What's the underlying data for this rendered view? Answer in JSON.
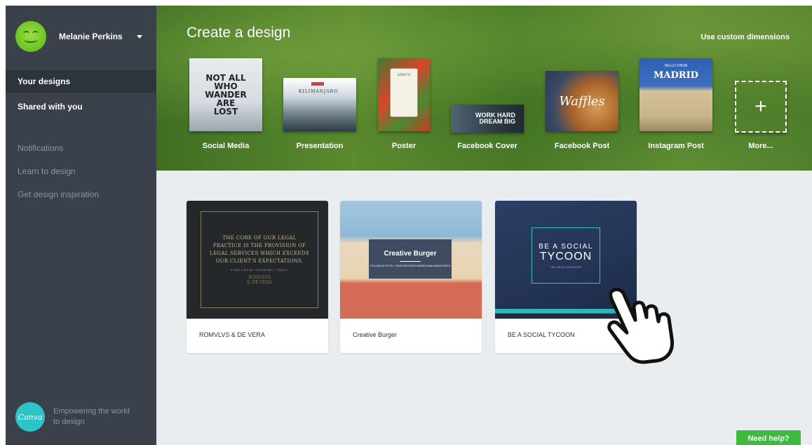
{
  "sidebar": {
    "user_name": "Melanie Perkins",
    "nav": [
      {
        "label": "Your designs",
        "active": true
      },
      {
        "label": "Shared with you",
        "active": false
      }
    ],
    "secondary": [
      {
        "label": "Notifications"
      },
      {
        "label": "Learn to design"
      },
      {
        "label": "Get design inspiration"
      }
    ],
    "brand": {
      "logo_text": "Canva",
      "tagline": "Empowering the world to design"
    }
  },
  "header": {
    "title": "Create a design",
    "custom_dimensions": "Use custom dimensions",
    "design_types": [
      {
        "label": "Social Media",
        "thumb_text": "NOT ALL WHO WANDER ARE LOST"
      },
      {
        "label": "Presentation",
        "thumb_text": "KILIMANJARO"
      },
      {
        "label": "Poster",
        "thumb_text": "ABBY'S"
      },
      {
        "label": "Facebook Cover",
        "thumb_text_1": "WORK HARD",
        "thumb_text_2": "DREAM BIG"
      },
      {
        "label": "Facebook Post",
        "thumb_text": "Waffles"
      },
      {
        "label": "Instagram Post",
        "thumb_small": "HELLO FROM",
        "thumb_text": "MADRID"
      },
      {
        "label": "More...",
        "thumb_text": "+"
      }
    ]
  },
  "designs": [
    {
      "title": "ROMVLVS & DE VERA",
      "preview_quote": "THE CORE OF OUR LEGAL PRACTICE IS THE PROVISION OF LEGAL SERVICES WHICH EXCEEDS OUR CLIENT'S EXPECTATIONS.",
      "preview_small": "FIND LEGAL COUNSEL TODAY",
      "preview_firm_1": "ROMVLVS",
      "preview_firm_2": "& DE VERA"
    },
    {
      "title": "Creative Burger",
      "preview_heading": "Creative Burger",
      "preview_sub": "FOLLOW US TO FILL YOUR FEED WITH BURGER AND MEDIA POSTS"
    },
    {
      "title": "BE A SOCIAL TYCOON",
      "preview_line1": "BE A SOCIAL",
      "preview_line2": "TYCOON",
      "preview_sub": "THE CAPITAL STRATEGIST"
    }
  ],
  "help_button": "Need help?",
  "colors": {
    "sidebar_bg": "#3a414b",
    "main_bg": "#eaedef",
    "brand_teal": "#2bc5c9",
    "help_green": "#3fb93f"
  }
}
